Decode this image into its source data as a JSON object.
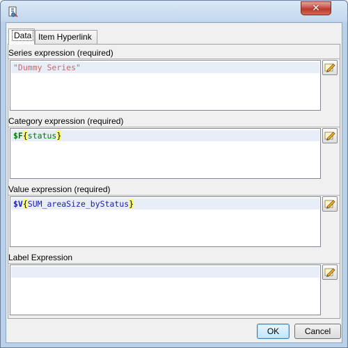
{
  "window": {
    "title": "",
    "close_glyph": "✕"
  },
  "tabs": [
    {
      "label": "Data",
      "active": true
    },
    {
      "label": "Item Hyperlink",
      "active": false
    }
  ],
  "sections": {
    "series": {
      "label": "Series expression (required)",
      "value": "\"Dummy Series\""
    },
    "category": {
      "label": "Category expression (required)",
      "prefix": "$F",
      "open": "{",
      "field": "status",
      "close": "}"
    },
    "value": {
      "label": "Value expression (required)",
      "prefix": "$V",
      "open": "{",
      "field": "SUM_areaSize_byStatus",
      "close": "}"
    },
    "label": {
      "label": "Label Expression",
      "value": ""
    }
  },
  "buttons": {
    "ok": "OK",
    "cancel": "Cancel"
  },
  "icons": {
    "app": "jasper-report-icon",
    "expression_editor": "pencil-edit-icon"
  },
  "colors": {
    "string_literal": "#c46a6a",
    "field_ref": "#007a00",
    "variable_ref": "#1a1ab0",
    "brace_highlight": "#ffff5a",
    "line_highlight": "#e8eef8"
  }
}
